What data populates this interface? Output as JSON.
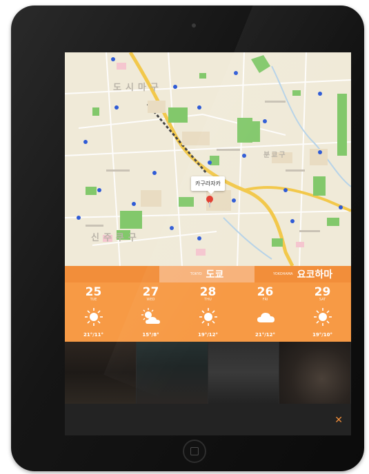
{
  "map": {
    "districts": [
      "도시마구",
      "신주쿠구",
      "분쿄구"
    ],
    "callout": "카구라자카"
  },
  "city_bar": {
    "current": {
      "sub_en": "TOKYO",
      "name": "도쿄"
    },
    "next": {
      "sub_en": "YOKOHAMA",
      "name": "요코하마"
    }
  },
  "forecast": [
    {
      "temp": "25",
      "day": "TUE",
      "icon": "sun-icon",
      "range": "21°/11°"
    },
    {
      "temp": "27",
      "day": "WED",
      "icon": "sun-cloud-icon",
      "range": "15°/8°"
    },
    {
      "temp": "28",
      "day": "THU",
      "icon": "sun-icon",
      "range": "19°/12°"
    },
    {
      "temp": "26",
      "day": "FRI",
      "icon": "cloud-icon",
      "range": "21°/12°"
    },
    {
      "temp": "29",
      "day": "SAT",
      "icon": "sun-icon",
      "range": "19°/10°"
    }
  ],
  "footer": {
    "close": "✕"
  },
  "colors": {
    "accent": "#f28e3a",
    "forecast_bg": "#f79a45",
    "active_city": "#f7b37c"
  }
}
